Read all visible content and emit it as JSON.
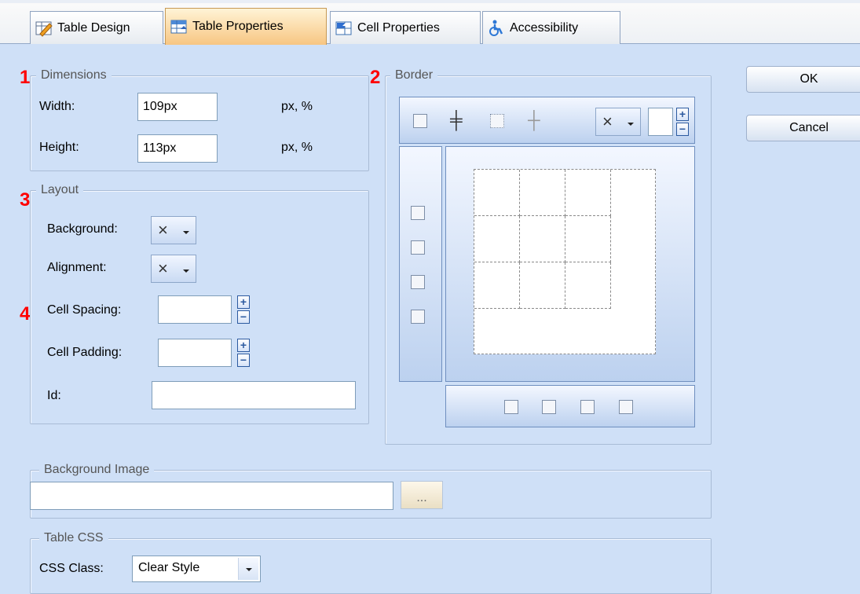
{
  "tabs": [
    {
      "label": "Table Design",
      "icon": "table-design-icon",
      "active": false
    },
    {
      "label": "Table Properties",
      "icon": "table-properties-icon",
      "active": true
    },
    {
      "label": "Cell Properties",
      "icon": "cell-properties-icon",
      "active": false
    },
    {
      "label": "Accessibility",
      "icon": "accessibility-icon",
      "active": false
    }
  ],
  "markers": {
    "m1": "1",
    "m2": "2",
    "m3": "3",
    "m4": "4"
  },
  "dimensions": {
    "legend": "Dimensions",
    "width_label": "Width:",
    "width_value": "109px",
    "width_unit": "px, %",
    "height_label": "Height:",
    "height_value": "113px",
    "height_unit": "px, %"
  },
  "layout": {
    "legend": "Layout",
    "background_label": "Background:",
    "background_value": "×",
    "alignment_label": "Alignment:",
    "alignment_value": "×",
    "cell_spacing_label": "Cell Spacing:",
    "cell_spacing_value": "",
    "cell_padding_label": "Cell Padding:",
    "cell_padding_value": "",
    "id_label": "Id:",
    "id_value": ""
  },
  "border": {
    "legend": "Border",
    "style_value": "×",
    "width_value": ""
  },
  "background_image": {
    "legend": "Background Image",
    "value": "",
    "browse_label": "..."
  },
  "table_css": {
    "legend": "Table CSS",
    "css_class_label": "CSS Class:",
    "css_class_value": "Clear Style"
  },
  "buttons": {
    "ok": "OK",
    "cancel": "Cancel"
  },
  "colors": {
    "panel_bg": "#cfe0f7",
    "active_tab": "#f7c682",
    "marker": "#ff0000"
  }
}
